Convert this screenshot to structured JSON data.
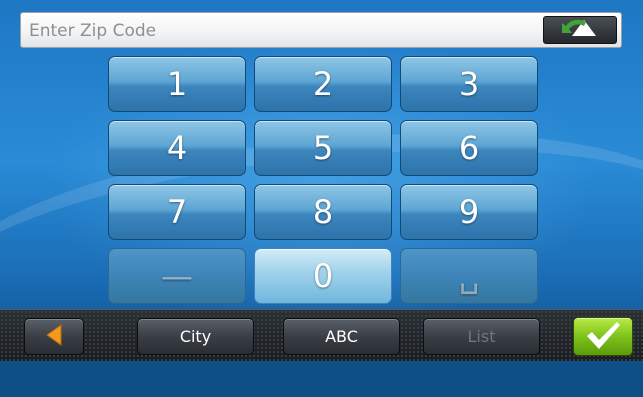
{
  "zip_input": {
    "placeholder": "Enter Zip Code",
    "value": ""
  },
  "header": {
    "backspace_icon": "backspace-arrow-icon"
  },
  "keypad": {
    "keys": [
      "1",
      "2",
      "3",
      "4",
      "5",
      "6",
      "7",
      "8",
      "9",
      "—",
      "0",
      "␣"
    ]
  },
  "toolbar": {
    "back_icon": "arrow-left-icon",
    "city_label": "City",
    "abc_label": "ABC",
    "list_label": "List",
    "ok_icon": "checkmark-icon"
  },
  "colors": {
    "accent": "#2a8bd6",
    "ok": "#7fc21c",
    "back_arrow": "#f39a1e"
  }
}
